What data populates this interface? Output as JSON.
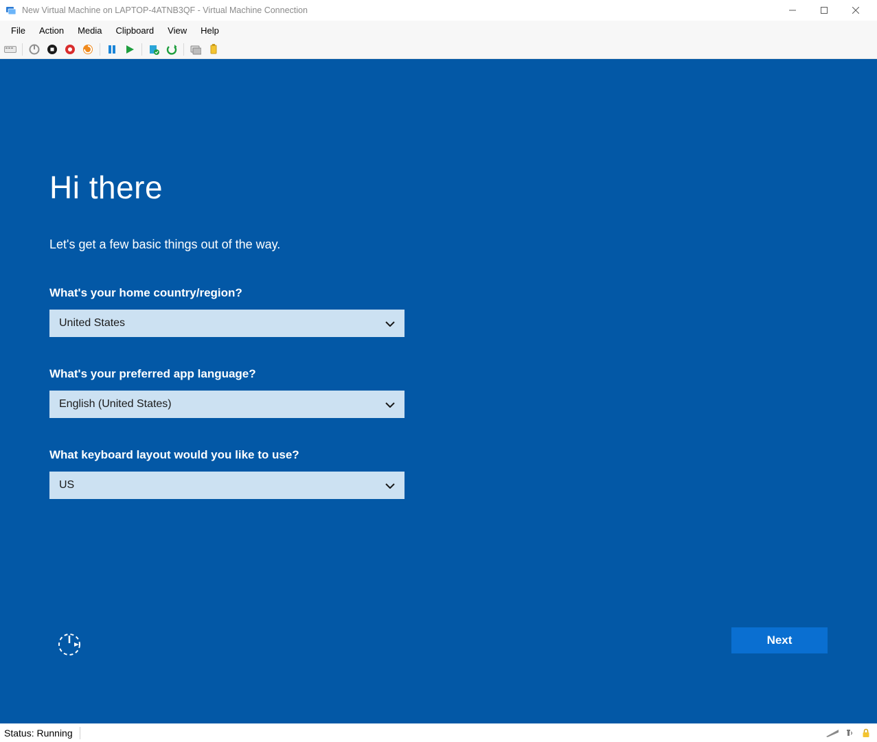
{
  "window": {
    "title": "New Virtual Machine on LAPTOP-4ATNB3QF - Virtual Machine Connection"
  },
  "menu": {
    "items": [
      "File",
      "Action",
      "Media",
      "Clipboard",
      "View",
      "Help"
    ]
  },
  "toolbar": {
    "icons": [
      "ctrl-alt-del",
      "turn-off",
      "shutdown",
      "save",
      "reset",
      "pause",
      "start",
      "checkpoint",
      "revert",
      "enhanced-session",
      "share"
    ]
  },
  "oobe": {
    "heading": "Hi there",
    "subtitle": "Let's get a few basic things out of the way.",
    "q1_label": "What's your home country/region?",
    "q1_value": "United States",
    "q2_label": "What's your preferred app language?",
    "q2_value": "English (United States)",
    "q3_label": "What keyboard layout would you like to use?",
    "q3_value": "US",
    "next_label": "Next"
  },
  "status": {
    "text": "Status: Running"
  }
}
